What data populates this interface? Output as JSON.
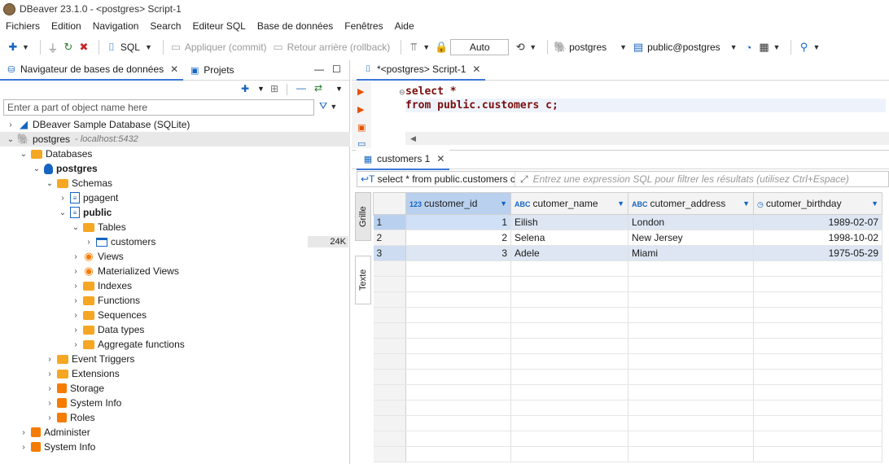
{
  "window": {
    "title": "DBeaver 23.1.0 - <postgres> Script-1"
  },
  "menu": [
    "Fichiers",
    "Edition",
    "Navigation",
    "Search",
    "Editeur SQL",
    "Base de données",
    "Fenêtres",
    "Aide"
  ],
  "toolbar": {
    "sql_label": "SQL",
    "commit_label": "Appliquer (commit)",
    "rollback_label": "Retour arrière (rollback)",
    "transaction_mode": "Auto",
    "connection": "postgres",
    "schema": "public@postgres"
  },
  "navigator": {
    "tab_label": "Navigateur de bases de données",
    "projects_tab_label": "Projets",
    "filter_placeholder": "Enter a part of object name here",
    "tree": {
      "sample_db": "DBeaver Sample Database (SQLite)",
      "postgres": "postgres",
      "postgres_host": "- localhost:5432",
      "databases": "Databases",
      "db_postgres": "postgres",
      "schemas": "Schemas",
      "pgagent": "pgagent",
      "public": "public",
      "tables": "Tables",
      "customers": "customers",
      "customers_size": "24K",
      "views": "Views",
      "mviews": "Materialized Views",
      "indexes": "Indexes",
      "functions": "Functions",
      "sequences": "Sequences",
      "datatypes": "Data types",
      "aggregates": "Aggregate functions",
      "event_triggers": "Event Triggers",
      "extensions": "Extensions",
      "storage": "Storage",
      "system_info": "System Info",
      "roles": "Roles",
      "administer": "Administer",
      "system_info_root": "System Info"
    }
  },
  "editor": {
    "tab_label": "*<postgres> Script-1",
    "code": [
      "select *",
      "from public.customers c;"
    ]
  },
  "results": {
    "tab_label": "customers 1",
    "query_text": "select * from public.customers c",
    "filter_placeholder": "Entrez une expression SQL pour filtrer les résultats (utilisez Ctrl+Espace)",
    "side_tabs": {
      "grid": "Grille",
      "text": "Texte"
    },
    "columns": [
      {
        "name": "customer_id",
        "type_icon": "123"
      },
      {
        "name": "cutomer_name",
        "type_icon": "ABC"
      },
      {
        "name": "cutomer_address",
        "type_icon": "ABC"
      },
      {
        "name": "cutomer_birthday",
        "type_icon": "clock"
      }
    ],
    "rows": [
      {
        "n": "1",
        "id": "1",
        "name": "Eilish",
        "address": "London",
        "birthday": "1989-02-07"
      },
      {
        "n": "2",
        "id": "2",
        "name": "Selena",
        "address": "New Jersey",
        "birthday": "1998-10-02"
      },
      {
        "n": "3",
        "id": "3",
        "name": "Adele",
        "address": "Miami",
        "birthday": "1975-05-29"
      }
    ]
  }
}
